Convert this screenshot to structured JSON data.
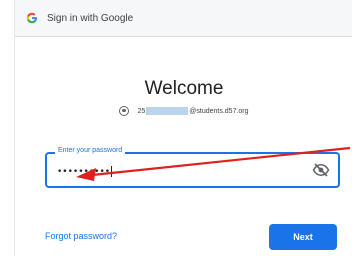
{
  "window": {
    "title": "Sign in with Google"
  },
  "main": {
    "heading": "Welcome",
    "account": {
      "email_prefix": "25",
      "email_domain": "@students.d57.org"
    },
    "password_field": {
      "label": "Enter your password",
      "masked_value": "••••••••••"
    },
    "forgot_password": "Forgot password?",
    "next_button": "Next"
  },
  "colors": {
    "accent": "#1a73e8",
    "annotation_arrow": "#e0201e",
    "redaction": "#bcd3ec"
  },
  "icons": {
    "logo": "google-g-icon",
    "avatar": "account-circle-icon",
    "visibility_toggle": "eye-off-icon"
  }
}
